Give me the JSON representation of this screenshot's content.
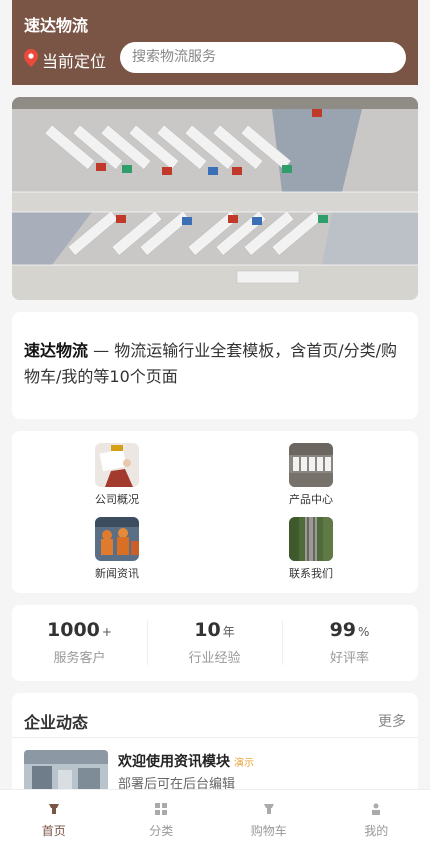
{
  "header": {
    "title": "速达物流",
    "location_label": "当前定位",
    "search_placeholder": "搜索物流服务"
  },
  "intro": {
    "brand": "速达物流",
    "text": " — 物流运输行业全套模板，含首页/分类/购物车/我的等10个页面"
  },
  "grid": [
    {
      "label": "公司概况",
      "icon": "company-photo"
    },
    {
      "label": "产品中心",
      "icon": "trucks-photo"
    },
    {
      "label": "新闻资讯",
      "icon": "news-photo"
    },
    {
      "label": "联系我们",
      "icon": "railway-photo"
    }
  ],
  "stats": [
    {
      "num": "1000",
      "unit": "+",
      "label": "服务客户"
    },
    {
      "num": "10",
      "unit": "年",
      "label": "行业经验"
    },
    {
      "num": "99",
      "unit": "%",
      "label": "好评率"
    }
  ],
  "news": {
    "title": "企业动态",
    "more": "更多",
    "item": {
      "title": "欢迎使用资讯模块",
      "tag": "演示",
      "subtitle": "部署后可在后台编辑"
    }
  },
  "tabs": [
    {
      "label": "首页",
      "icon": "home-icon",
      "active": true
    },
    {
      "label": "分类",
      "icon": "category-icon",
      "active": false
    },
    {
      "label": "购物车",
      "icon": "cart-icon",
      "active": false
    },
    {
      "label": "我的",
      "icon": "user-icon",
      "active": false
    }
  ],
  "colors": {
    "brand": "#7a5445",
    "accent": "#e6a23c"
  }
}
